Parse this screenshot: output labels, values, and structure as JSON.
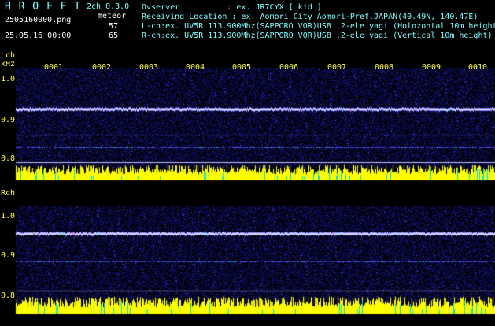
{
  "header": {
    "app_title": "H R O F F T",
    "channel_version": "2ch 0.3.0",
    "filename": "2505160000.png",
    "mode": "meteor",
    "datetime": "25.05.16 00:00",
    "count_l": "57",
    "count_r": "65",
    "observer_line": "Ovserver          : ex. JR7CYX [ kid ]",
    "location_line": "Receiving Location : ex. Aomori City Aomori-Pref.JAPAN(40.49N, 140.47E)",
    "lch_line": "L-ch:ex. UV5R 113.900Mhz(SAPPORO VOR)USB ,2-ele yagi (Holozontal 10m height)",
    "rch_line": "R-ch:ex. UV5R 113.900Mhz(SAPPORO VOR)USB ,2-ele yagi (Vertical 10m height)"
  },
  "lch": {
    "label": "Lch",
    "unit": "kHz",
    "y_ticks": [
      "1.0",
      "0.9",
      "0.8"
    ],
    "minute_labels": [
      "0001",
      "0002",
      "0003",
      "0004",
      "0005",
      "0006",
      "0007",
      "0008",
      "0009",
      "0010"
    ]
  },
  "rch": {
    "label": "Rch",
    "y_ticks": [
      "1.0",
      "0.9",
      "0.8"
    ]
  },
  "colors": {
    "background": "#000000",
    "noise_base": "#0a0a55",
    "signal_line": "#d0d0ff",
    "bars": "#ffff00",
    "bar_spikes": "#00ffff",
    "label_cyan": "#7fffff",
    "label_white": "#ffffff"
  }
}
